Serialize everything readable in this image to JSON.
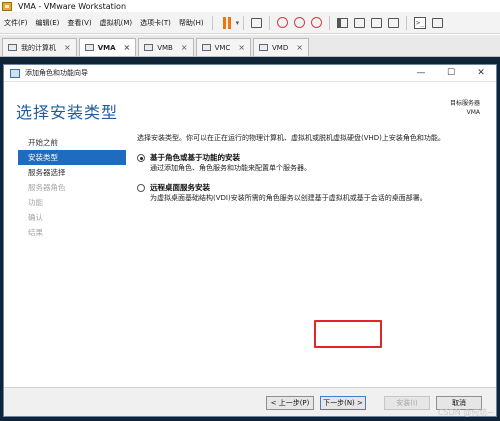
{
  "window": {
    "title": "VMA - VMware Workstation"
  },
  "menu": {
    "items": [
      "文件(F)",
      "编辑(E)",
      "查看(V)",
      "虚拟机(M)",
      "选项卡(T)",
      "帮助(H)"
    ]
  },
  "tabs": [
    {
      "label": "我的计算机",
      "active": false
    },
    {
      "label": "VMA",
      "active": true
    },
    {
      "label": "VMB",
      "active": false
    },
    {
      "label": "VMC",
      "active": false
    },
    {
      "label": "VMD",
      "active": false
    }
  ],
  "wizard": {
    "title": "添加角色和功能向导",
    "heading": "选择安装类型",
    "destination_label": "目标服务器",
    "destination_value": "VMA",
    "steps": [
      {
        "label": "开始之前",
        "state": "normal"
      },
      {
        "label": "安装类型",
        "state": "active"
      },
      {
        "label": "服务器选择",
        "state": "normal"
      },
      {
        "label": "服务器角色",
        "state": "disabled"
      },
      {
        "label": "功能",
        "state": "disabled"
      },
      {
        "label": "确认",
        "state": "disabled"
      },
      {
        "label": "结果",
        "state": "disabled"
      }
    ],
    "intro": "选择安装类型。你可以在正在运行的物理计算机、虚拟机或脱机虚拟硬盘(VHD)上安装角色和功能。",
    "options": [
      {
        "title": "基于角色或基于功能的安装",
        "description": "通过添加角色、角色服务和功能来配置单个服务器。",
        "selected": true
      },
      {
        "title": "远程桌面服务安装",
        "description": "为虚拟桌面基础结构(VDI)安装所需的角色服务以创建基于虚拟机或基于会话的桌面部署。",
        "selected": false
      }
    ],
    "buttons": {
      "previous": "< 上一步(P)",
      "next": "下一步(N) >",
      "install": "安装(I)",
      "cancel": "取消"
    }
  },
  "watermark": "CSDN @何坊~",
  "colors": {
    "accent": "#1f6bbf",
    "heading": "#1f5e9c",
    "highlight": "#e0262a",
    "pause": "#f0750f"
  }
}
